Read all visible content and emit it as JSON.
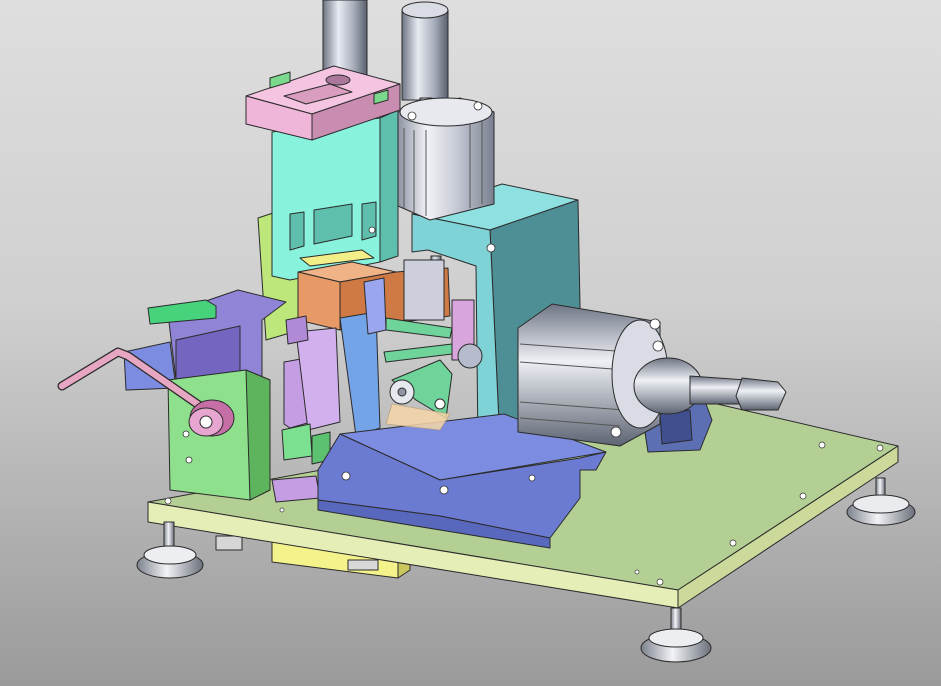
{
  "viewport": {
    "background_top": "#dedede",
    "background_bottom": "#9a9a9a"
  },
  "colors": {
    "base_plate": "#b4cf94",
    "base_plate_side": "#e6eeb8",
    "frame_cyan": "#7fd3d6",
    "frame_cyan_dark": "#4e8f95",
    "upper_block_mint": "#88f2dd",
    "top_cap_pink": "#f0b6d9",
    "copper_block": "#e89a66",
    "rail_blue": "#7c8ce0",
    "slide_purple": "#8f84d6",
    "green_block": "#8fe08d",
    "lilac_parts": "#c59de3",
    "arm_green": "#6ed49a",
    "crank_pink": "#e7a6c2",
    "cylinder_silver": "#c9cdd8",
    "yellow_box": "#f4f28a"
  },
  "components": [
    "base-plate",
    "leveling-foot",
    "main-frame",
    "vertical-cylinder",
    "horizontal-cylinder",
    "upper-guide-block",
    "top-cap",
    "copper-die-block",
    "lower-rail",
    "left-slide",
    "hand-crank",
    "green-side-block",
    "linkage-arm",
    "mount-bracket"
  ]
}
